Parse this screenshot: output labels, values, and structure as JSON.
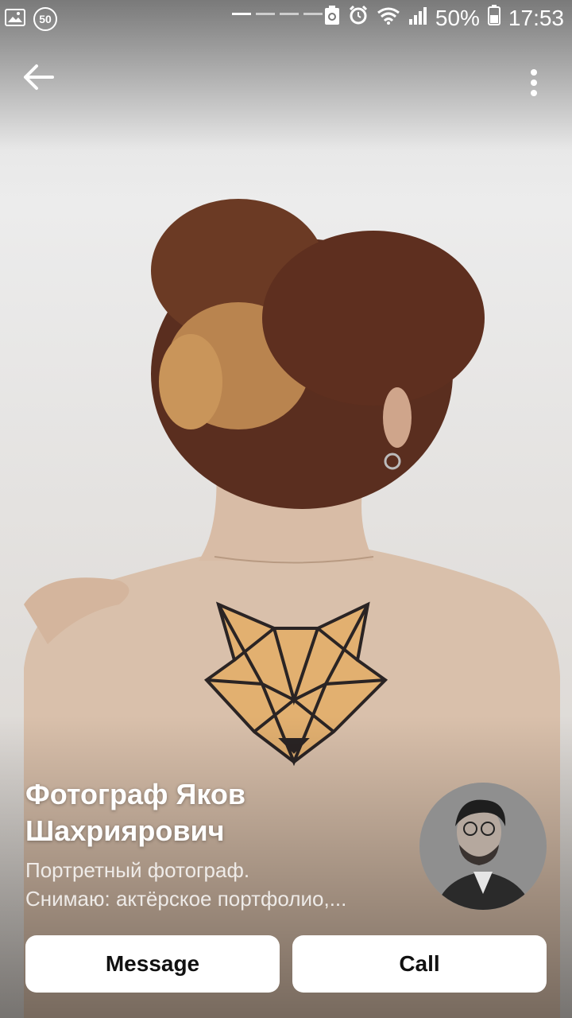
{
  "status_bar": {
    "notification_badge": "50",
    "battery": "50%",
    "time": "17:53",
    "icons": [
      "image-icon",
      "sync-icon",
      "alarm-icon",
      "wifi-icon",
      "signal-icon",
      "battery-icon"
    ]
  },
  "top_bar": {
    "back_icon": "arrow-left-icon",
    "menu_icon": "more-vertical-icon"
  },
  "profile": {
    "name_line1": "Фотограф Яков",
    "name_line2": "Шахриярович",
    "bio_line1": "Портретный фотограф.",
    "bio_line2": "Снимаю: актёрское портфолио,..."
  },
  "actions": {
    "message_label": "Message",
    "call_label": "Call"
  },
  "colors": {
    "button_bg": "#ffffff",
    "button_text": "#111111",
    "overlay_text": "#ffffff"
  }
}
